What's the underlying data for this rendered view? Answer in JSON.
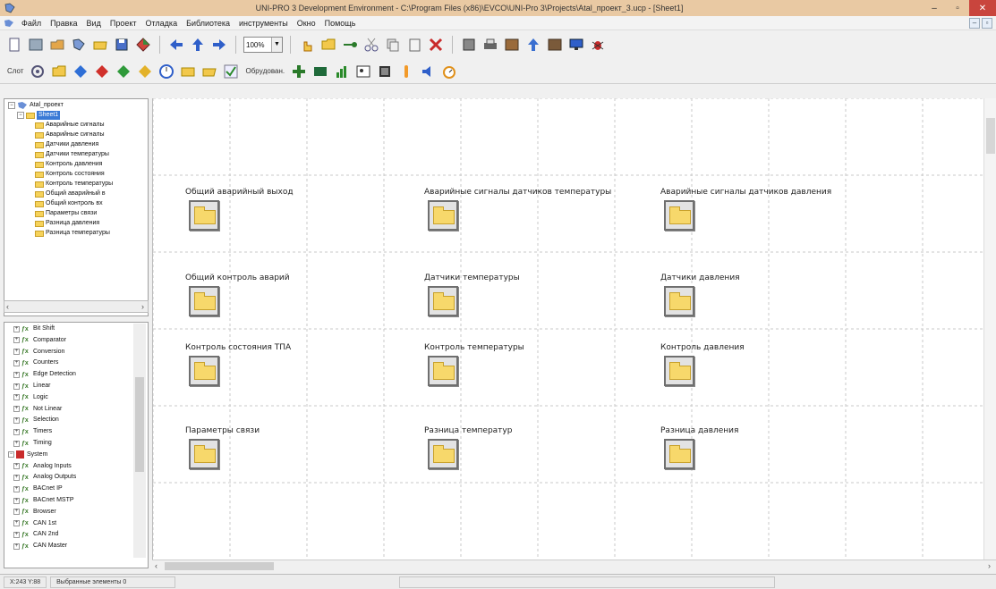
{
  "window": {
    "title": "UNI-PRO 3 Development Environment - C:\\Program Files (x86)\\EVCO\\UNI-Pro 3\\Projects\\Atal_проект_3.ucp - [Sheet1]",
    "controls": [
      "–",
      "▫",
      "✕"
    ]
  },
  "menu": {
    "items": [
      "Файл",
      "Правка",
      "Вид",
      "Проект",
      "Отладка",
      "Библиотека",
      "инструменты",
      "Окно",
      "Помощь"
    ],
    "mdi_controls": [
      "–",
      "▫"
    ]
  },
  "toolbar1": {
    "zoom_value": "100%"
  },
  "toolbar2": {
    "first_label": "Слот",
    "mid_label": "Обрyдован."
  },
  "project_tree": {
    "root": "Atal_проект",
    "sheet": "Sheet1",
    "items": [
      "Аварийные сигналы",
      "Аварийные сигналы",
      "Датчики давления",
      "Датчики температуры",
      "Контроль давления",
      "Контроль состояния",
      "Контроль температуры",
      "Общий аварийный в",
      "Общий контроль вх",
      "Параметры связи",
      "Разница давления",
      "Разница температуры"
    ]
  },
  "library_tree": {
    "items": [
      {
        "label": "Bit Shift",
        "level": 1
      },
      {
        "label": "Comparator",
        "level": 1
      },
      {
        "label": "Conversion",
        "level": 1
      },
      {
        "label": "Counters",
        "level": 1
      },
      {
        "label": "Edge Detection",
        "level": 1
      },
      {
        "label": "Linear",
        "level": 1
      },
      {
        "label": "Logic",
        "level": 1
      },
      {
        "label": "Not Linear",
        "level": 1
      },
      {
        "label": "Selection",
        "level": 1
      },
      {
        "label": "Timers",
        "level": 1
      },
      {
        "label": "Timing",
        "level": 1
      },
      {
        "label": "System",
        "level": 0
      },
      {
        "label": "Analog Inputs",
        "level": 1
      },
      {
        "label": "Analog Outputs",
        "level": 1
      },
      {
        "label": "BACnet IP",
        "level": 1
      },
      {
        "label": "BACnet MSTP",
        "level": 1
      },
      {
        "label": "Browser",
        "level": 1
      },
      {
        "label": "CAN 1st",
        "level": 1
      },
      {
        "label": "CAN 2nd",
        "level": 1
      },
      {
        "label": "CAN Master",
        "level": 1
      }
    ]
  },
  "canvas": {
    "blocks": [
      {
        "label": "Общий аварийный выход"
      },
      {
        "label": "Аварийные сигналы датчиков температуры"
      },
      {
        "label": "Аварийные сигналы датчиков давления"
      },
      {
        "label": "Общий контроль аварий"
      },
      {
        "label": "Датчики температуры"
      },
      {
        "label": "Датчики давления"
      },
      {
        "label": "Контроль состояния ТПА"
      },
      {
        "label": "Контроль температуры"
      },
      {
        "label": "Контроль давления"
      },
      {
        "label": "Параметры связи"
      },
      {
        "label": "Разница температур"
      },
      {
        "label": "Разница давления"
      }
    ]
  },
  "status": {
    "coords": "X:243 Y:88",
    "selected": "Выбранные элементы 0"
  },
  "colors": {
    "titlebar": "#e9c9a3",
    "close_button": "#c9453d",
    "folder": "#f7d86b"
  }
}
